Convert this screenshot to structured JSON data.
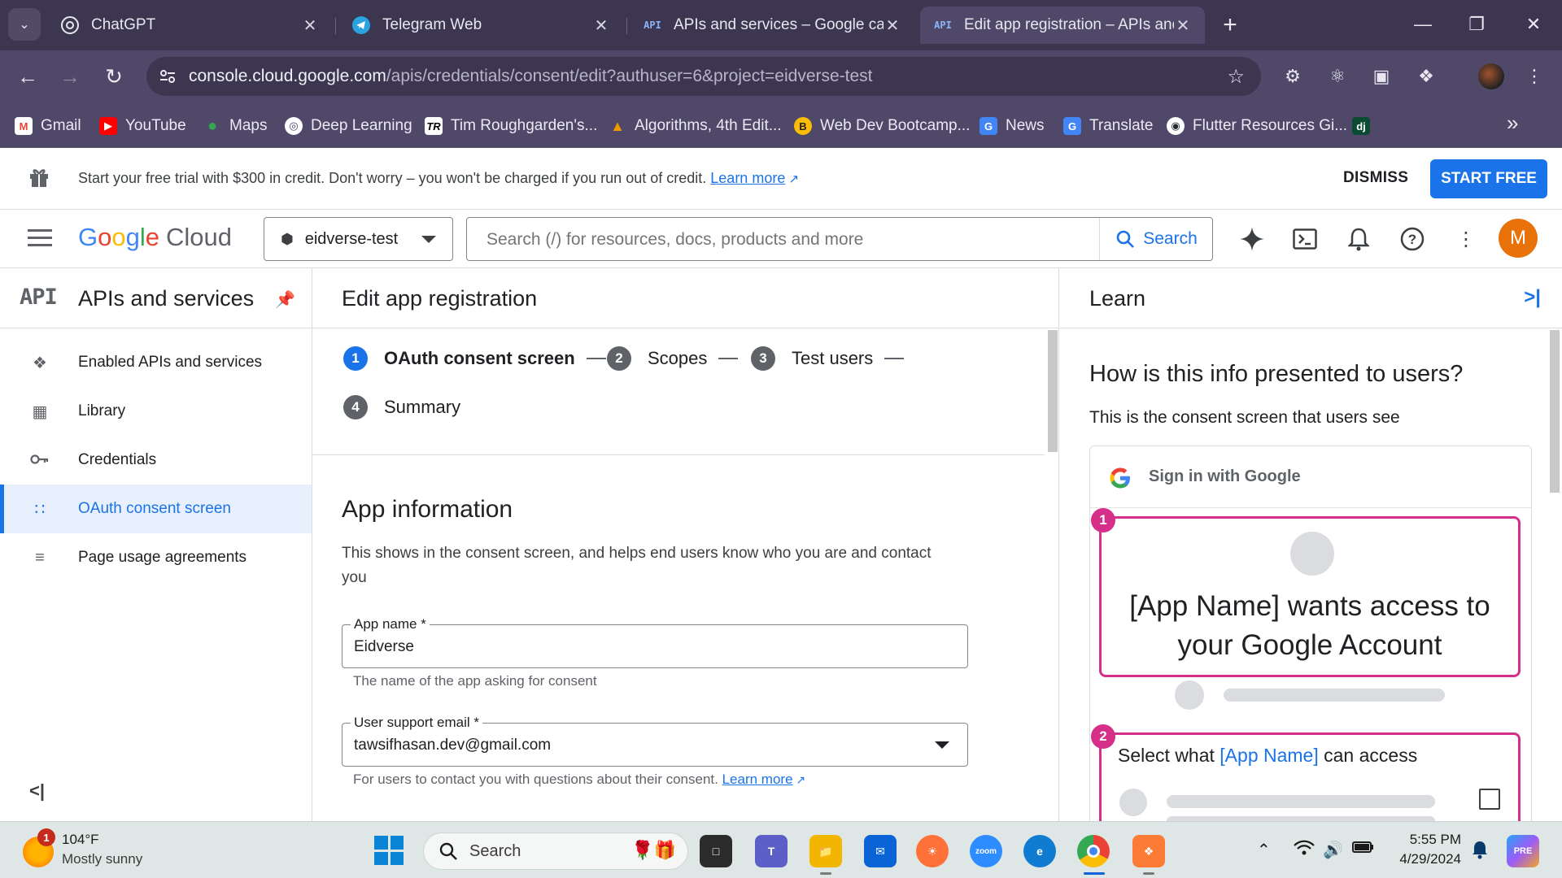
{
  "browser": {
    "tabs": [
      {
        "title": "ChatGPT",
        "active": false
      },
      {
        "title": "Telegram Web",
        "active": false
      },
      {
        "title": "APIs and services – Google cale",
        "active": false
      },
      {
        "title": "Edit app registration – APIs and",
        "active": true
      }
    ],
    "url_host": "console.cloud.google.com",
    "url_path": "/apis/credentials/consent/edit?authuser=6&project=eidverse-test",
    "bookmarks": [
      {
        "label": "Gmail",
        "icon": "gmail-icon",
        "color": "#ea4335"
      },
      {
        "label": "YouTube",
        "icon": "youtube-icon",
        "color": "#ff0000"
      },
      {
        "label": "Maps",
        "icon": "maps-icon",
        "color": "#34a853"
      },
      {
        "label": "Deep Learning",
        "icon": "globe-icon",
        "color": "#ffffff"
      },
      {
        "label": "Tim Roughgarden's...",
        "icon": "tr-icon",
        "color": "#ffffff"
      },
      {
        "label": "Algorithms, 4th Edit...",
        "icon": "algorithms-icon",
        "color": "#f29900"
      },
      {
        "label": "Web Dev Bootcamp...",
        "icon": "bootcamp-icon",
        "color": "#fbbc04"
      },
      {
        "label": "News",
        "icon": "news-icon",
        "color": "#4285f4"
      },
      {
        "label": "Translate",
        "icon": "translate-icon",
        "color": "#4285f4"
      },
      {
        "label": "Flutter Resources Gi...",
        "icon": "github-icon",
        "color": "#24292f"
      },
      {
        "label": "",
        "icon": "django-icon",
        "color": "#0c4b33"
      }
    ]
  },
  "banner": {
    "message": "Start your free trial with $300 in credit. Don't worry – you won't be charged if you run out of credit.",
    "learn_more": "Learn more",
    "dismiss": "DISMISS",
    "start_free": "START FREE"
  },
  "header": {
    "logo_google": "Google",
    "logo_cloud": "Cloud",
    "project": "eidverse-test",
    "search_placeholder": "Search (/) for resources, docs, products and more",
    "search_button": "Search",
    "user_initial": "M"
  },
  "sidebar": {
    "product_icon": "API",
    "title": "APIs and services",
    "items": [
      {
        "label": "Enabled APIs and services",
        "icon": "enabled-apis-icon",
        "active": false
      },
      {
        "label": "Library",
        "icon": "library-icon",
        "active": false
      },
      {
        "label": "Credentials",
        "icon": "key-icon",
        "active": false
      },
      {
        "label": "OAuth consent screen",
        "icon": "oauth-icon",
        "active": true
      },
      {
        "label": "Page usage agreements",
        "icon": "agreements-icon",
        "active": false
      }
    ]
  },
  "main": {
    "page_title": "Edit app registration",
    "steps": [
      {
        "num": "1",
        "label": "OAuth consent screen",
        "active": true
      },
      {
        "num": "2",
        "label": "Scopes",
        "active": false
      },
      {
        "num": "3",
        "label": "Test users",
        "active": false
      },
      {
        "num": "4",
        "label": "Summary",
        "active": false
      }
    ],
    "section_title": "App information",
    "section_desc": "This shows in the consent screen, and helps end users know who you are and contact you",
    "app_name_label": "App name *",
    "app_name_value": "Eidverse",
    "app_name_hint": "The name of the app asking for consent",
    "email_label": "User support email *",
    "email_value": "tawsifhasan.dev@gmail.com",
    "email_hint": "For users to contact you with questions about their consent.",
    "email_hint_link": "Learn more"
  },
  "learn": {
    "title": "Learn",
    "question": "How is this info presented to users?",
    "subtitle": "This is the consent screen that users see",
    "sign_in": "Sign in with Google",
    "callout1_badge": "1",
    "callout1_text": "[App Name] wants access to your Google Account",
    "callout2_badge": "2",
    "callout2_prefix": "Select what ",
    "callout2_app": "[App Name]",
    "callout2_suffix": " can access"
  },
  "taskbar": {
    "weather_badge": "1",
    "temperature": "104°F",
    "condition": "Mostly sunny",
    "search": "Search",
    "time": "5:55 PM",
    "date": "4/29/2024"
  }
}
